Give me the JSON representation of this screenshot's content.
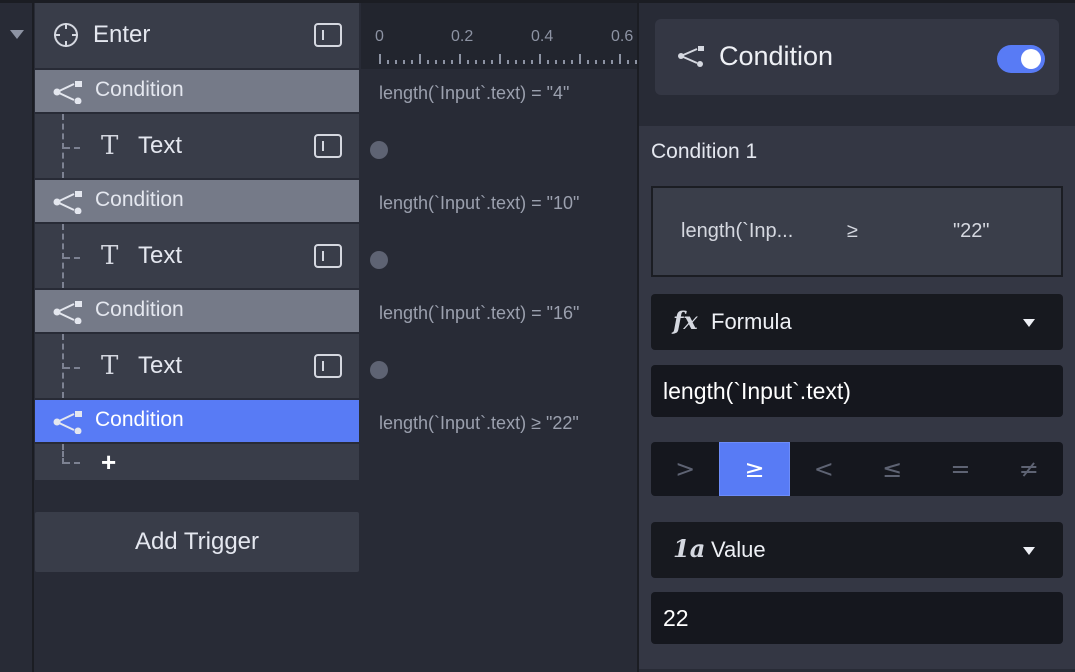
{
  "tree": {
    "trigger": {
      "label": "Enter",
      "icon": "target-icon"
    },
    "rows": [
      {
        "type": "condition",
        "label": "Condition",
        "active": false
      },
      {
        "type": "action",
        "label": "Text"
      },
      {
        "type": "condition",
        "label": "Condition",
        "active": false
      },
      {
        "type": "action",
        "label": "Text"
      },
      {
        "type": "condition",
        "label": "Condition",
        "active": false
      },
      {
        "type": "action",
        "label": "Text"
      },
      {
        "type": "condition",
        "label": "Condition",
        "active": true
      }
    ],
    "add_label": "+",
    "text_icon_glyph": "T"
  },
  "add_trigger_label": "Add Trigger",
  "timeline": {
    "ruler_labels": [
      "0",
      "0.2",
      "0.4",
      "0.6"
    ],
    "conditions": [
      "length(`Input`.text) = \"4\"",
      "length(`Input`.text) = \"10\"",
      "length(`Input`.text) = \"16\"",
      "length(`Input`.text) ≥ \"22\""
    ]
  },
  "panel": {
    "title": "Condition",
    "enabled": true,
    "section_label": "Condition 1",
    "summary": {
      "left": "length(`Inp...",
      "operator": "≥",
      "right": "\"22\""
    },
    "left_operand": {
      "type_icon": "fx",
      "type_label": "Formula",
      "value": "length(`Input`.text)"
    },
    "operators": [
      ">",
      "≥",
      "<",
      "≤",
      "=",
      "≠"
    ],
    "selected_operator": "≥",
    "right_operand": {
      "type_icon": "1a",
      "type_label": "Value",
      "value": "22"
    }
  },
  "colors": {
    "accent": "#587bf5",
    "condition_row": "#757a88",
    "row": "#393d49",
    "background": "#282b36"
  }
}
